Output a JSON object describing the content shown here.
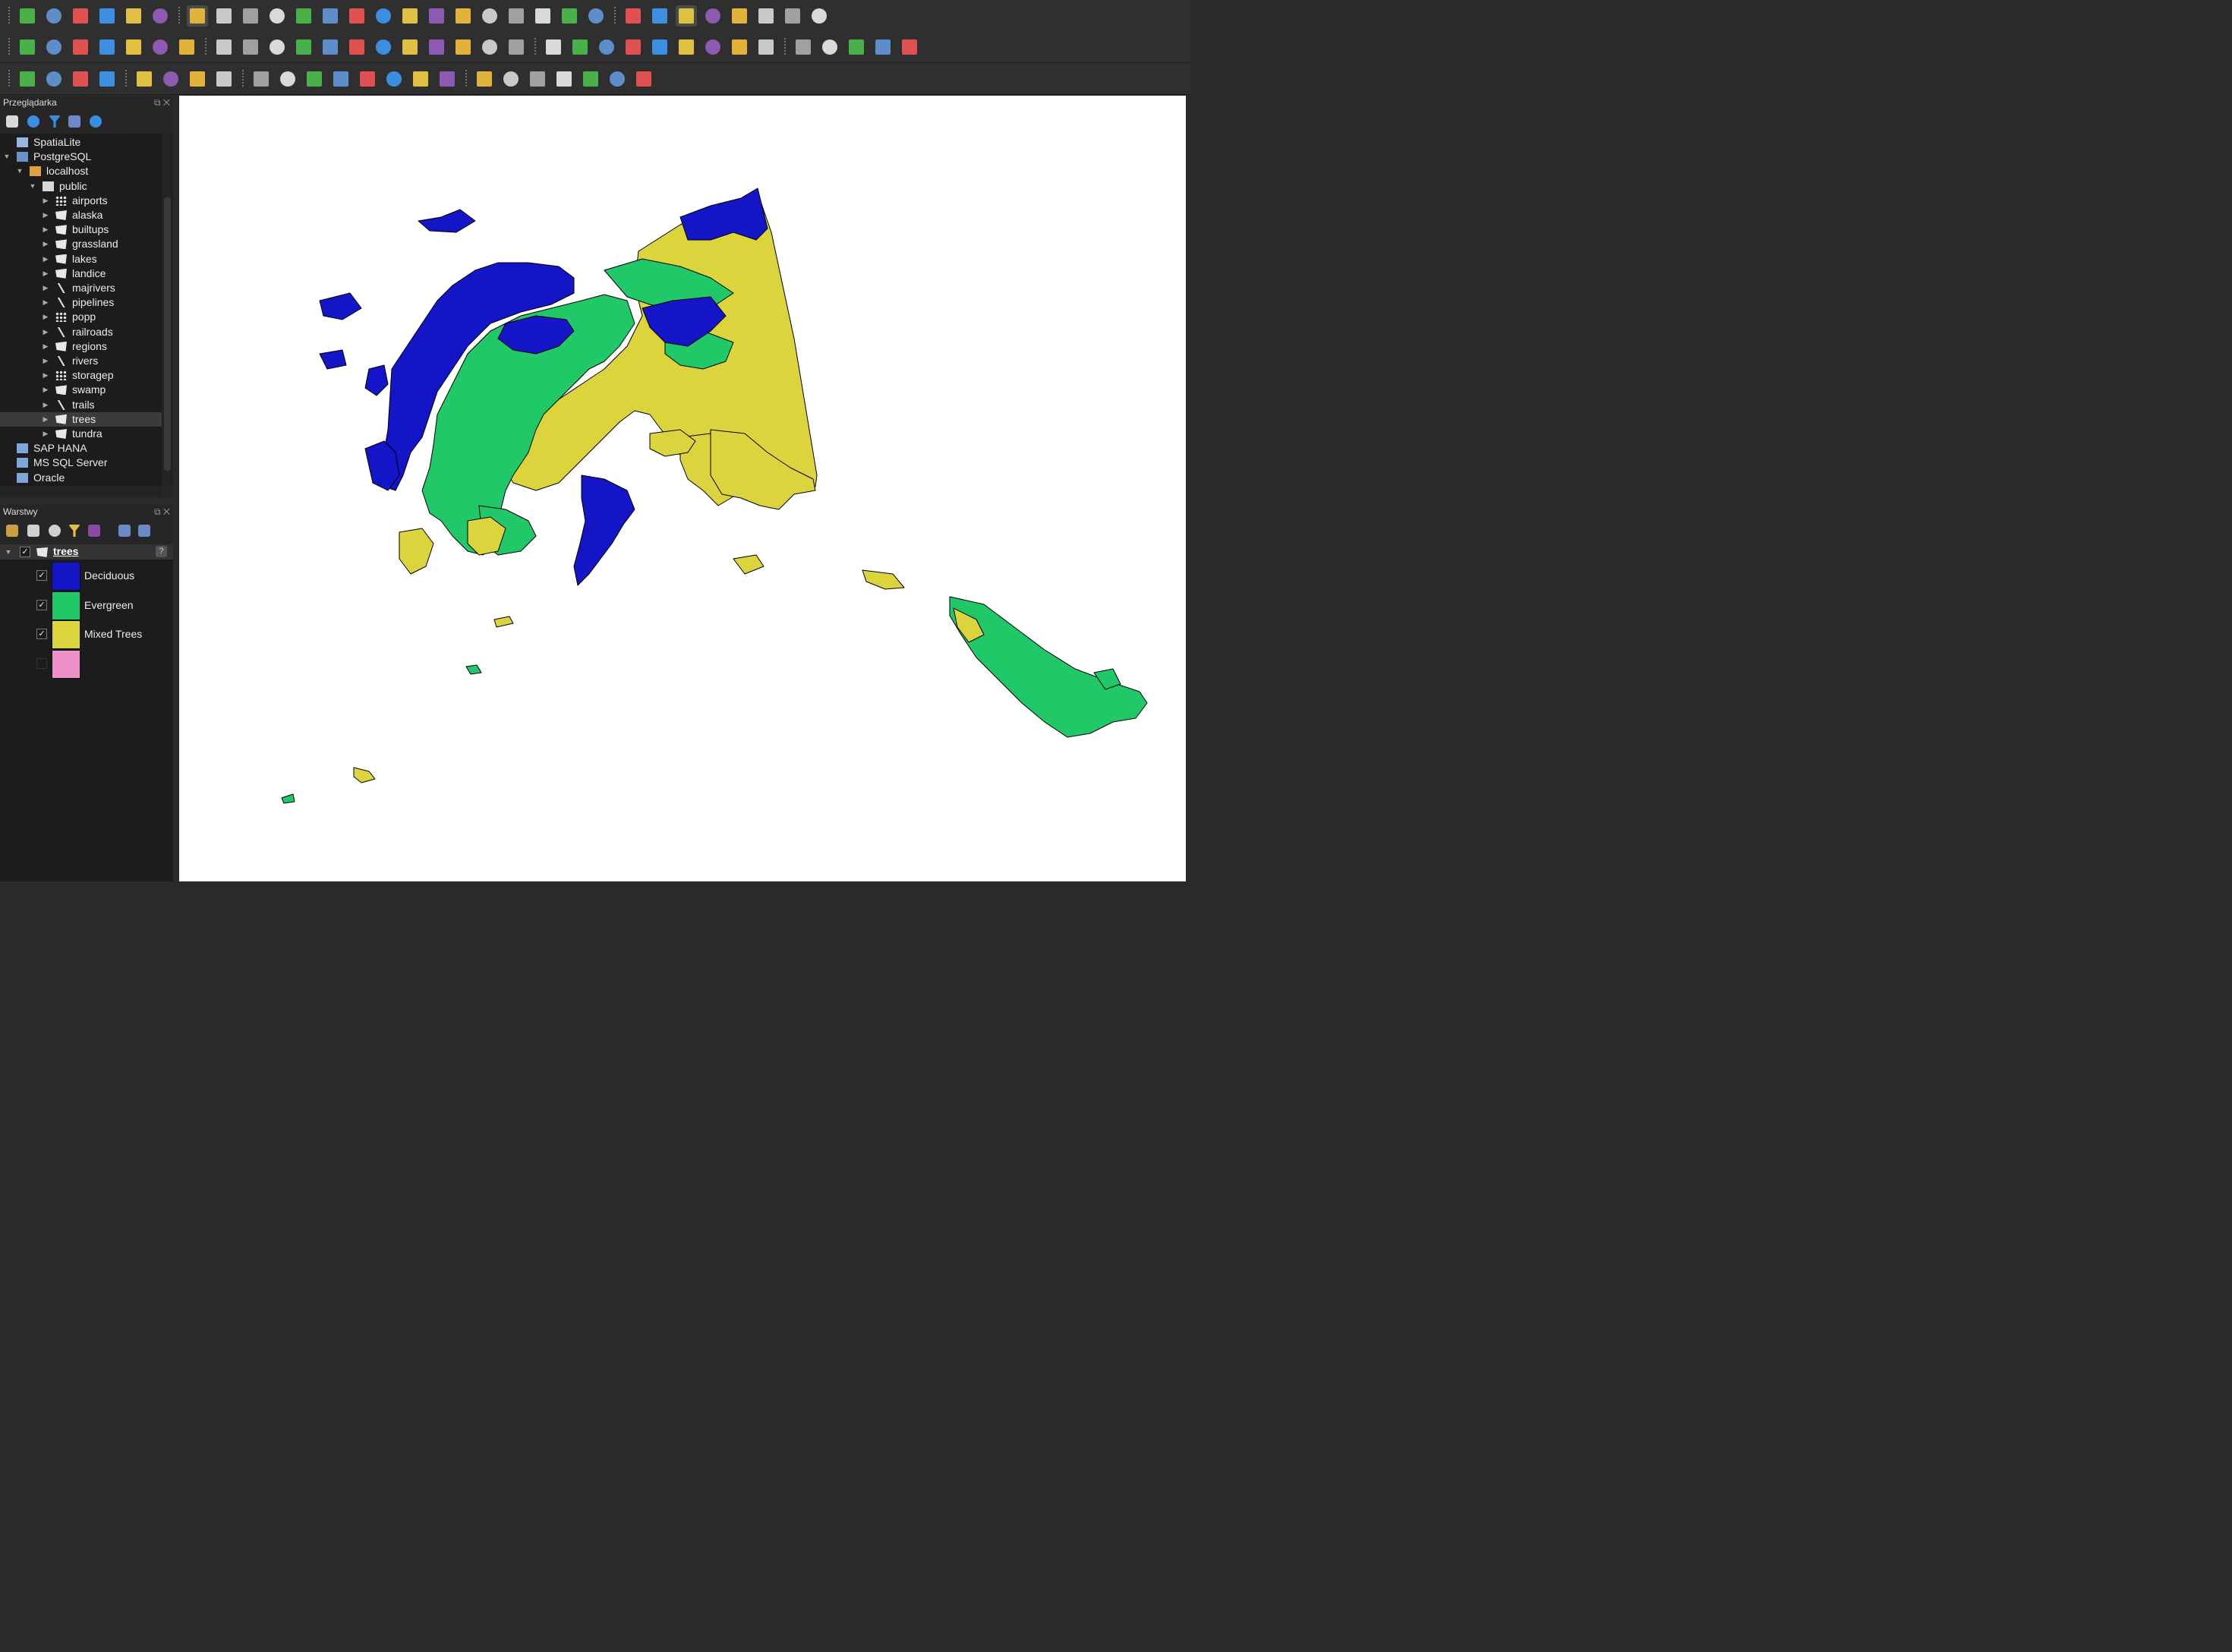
{
  "colors": {
    "deciduous": "#1515c8",
    "evergreen": "#20c868",
    "mixed_trees": "#dcd43c",
    "unclassified": "#f090c8",
    "map_background": "#ffffff",
    "panel_background": "#1c1c1c"
  },
  "toolbars": {
    "row1_icons": [
      "new-project-icon",
      "open-project-icon",
      "save-project-icon",
      "new-print-layout-icon",
      "layout-manager-icon",
      "style-manager-icon",
      "pan-map-icon",
      "pan-to-selection-icon",
      "zoom-in-icon",
      "zoom-out-icon",
      "zoom-full-icon",
      "zoom-to-selection-icon",
      "zoom-to-layer-icon",
      "zoom-native-resolution-icon",
      "zoom-last-icon",
      "zoom-next-icon",
      "new-map-view-icon",
      "new-3d-map-view-icon",
      "new-bookmark-icon",
      "show-bookmarks-icon",
      "temporal-controller-icon",
      "refresh-icon",
      "identify-features-icon",
      "open-attribute-table-icon",
      "toggle-processing-icon",
      "statistical-summary-icon",
      "open-field-calculator-icon",
      "measure-line-icon",
      "map-tips-icon",
      "toolbox-settings-icon"
    ],
    "row2_icons": [
      "data-source-manager-icon",
      "new-geopackage-layer-icon",
      "new-temporary-scratch-layer-icon",
      "new-spatialite-layer-icon",
      "new-shapefile-layer-icon",
      "new-virtual-layer-icon",
      "new-mesh-layer-icon",
      "current-edits-icon",
      "toggle-editing-icon",
      "save-layer-edits-icon",
      "digitize-line-icon",
      "vertex-tool-icon",
      "modify-attributes-icon",
      "delete-selected-icon",
      "cut-features-icon",
      "copy-features-icon",
      "paste-features-icon",
      "undo-icon",
      "redo-icon",
      "label-toolbar-icon",
      "pie-diagram-icon",
      "highlight-pinned-labels-icon",
      "pin-label-icon",
      "show-hide-labels-icon",
      "move-label-icon",
      "rotate-label-icon",
      "change-label-icon",
      "move-diagram-icon",
      "gps-track-icon",
      "globe-icon",
      "python-console-icon",
      "qgis-cloud-icon",
      "help-icon"
    ],
    "row3_icons": [
      "select-features-icon",
      "select-by-value-icon",
      "deselect-all-icon",
      "select-by-expression-icon",
      "advanced-digitizing-icon",
      "shape-digitizing-icon",
      "snapping-icon",
      "vertex-editor-icon",
      "text-annotation-icon",
      "select-move-annotation-icon",
      "add-vertex-icon",
      "add-node-icon",
      "favorite-star-icon",
      "add-text-icon",
      "html-annotation-icon",
      "text-annotation-t-icon",
      "measure-tool-icon",
      "north-arrow-icon",
      "add-grid-icon",
      "add-feature-icon",
      "geometry-checker-icon",
      "identify-info-icon",
      "settings-wrench-icon"
    ]
  },
  "browser": {
    "title": "Przeglądarka",
    "items": [
      {
        "label": "SpatiaLite",
        "icon": "spatialite-feather-icon"
      },
      {
        "label": "PostgreSQL",
        "icon": "postgresql-elephant-icon"
      },
      {
        "label": "localhost",
        "icon": "connection-icon"
      },
      {
        "label": "public",
        "icon": "schema-database-icon"
      },
      {
        "label": "airports",
        "icon": "point-layer-icon"
      },
      {
        "label": "alaska",
        "icon": "polygon-layer-icon"
      },
      {
        "label": "builtups",
        "icon": "polygon-layer-icon"
      },
      {
        "label": "grassland",
        "icon": "polygon-layer-icon"
      },
      {
        "label": "lakes",
        "icon": "polygon-layer-icon"
      },
      {
        "label": "landice",
        "icon": "polygon-layer-icon"
      },
      {
        "label": "majrivers",
        "icon": "line-layer-icon"
      },
      {
        "label": "pipelines",
        "icon": "line-layer-icon"
      },
      {
        "label": "popp",
        "icon": "point-layer-icon"
      },
      {
        "label": "railroads",
        "icon": "line-layer-icon"
      },
      {
        "label": "regions",
        "icon": "polygon-layer-icon"
      },
      {
        "label": "rivers",
        "icon": "line-layer-icon"
      },
      {
        "label": "storagep",
        "icon": "point-layer-icon"
      },
      {
        "label": "swamp",
        "icon": "polygon-layer-icon"
      },
      {
        "label": "trails",
        "icon": "line-layer-icon"
      },
      {
        "label": "trees",
        "icon": "polygon-layer-icon"
      },
      {
        "label": "tundra",
        "icon": "polygon-layer-icon"
      },
      {
        "label": "SAP HANA",
        "icon": "sap-hana-icon"
      },
      {
        "label": "MS SQL Server",
        "icon": "mssql-icon"
      },
      {
        "label": "Oracle",
        "icon": "oracle-icon"
      }
    ],
    "selected": "trees"
  },
  "layers": {
    "title": "Warstwy",
    "layer_name": "trees",
    "legend": [
      {
        "label": "Deciduous",
        "checked": true
      },
      {
        "label": "Evergreen",
        "checked": true
      },
      {
        "label": "Mixed Trees",
        "checked": true
      },
      {
        "label": "",
        "checked": false
      }
    ]
  }
}
